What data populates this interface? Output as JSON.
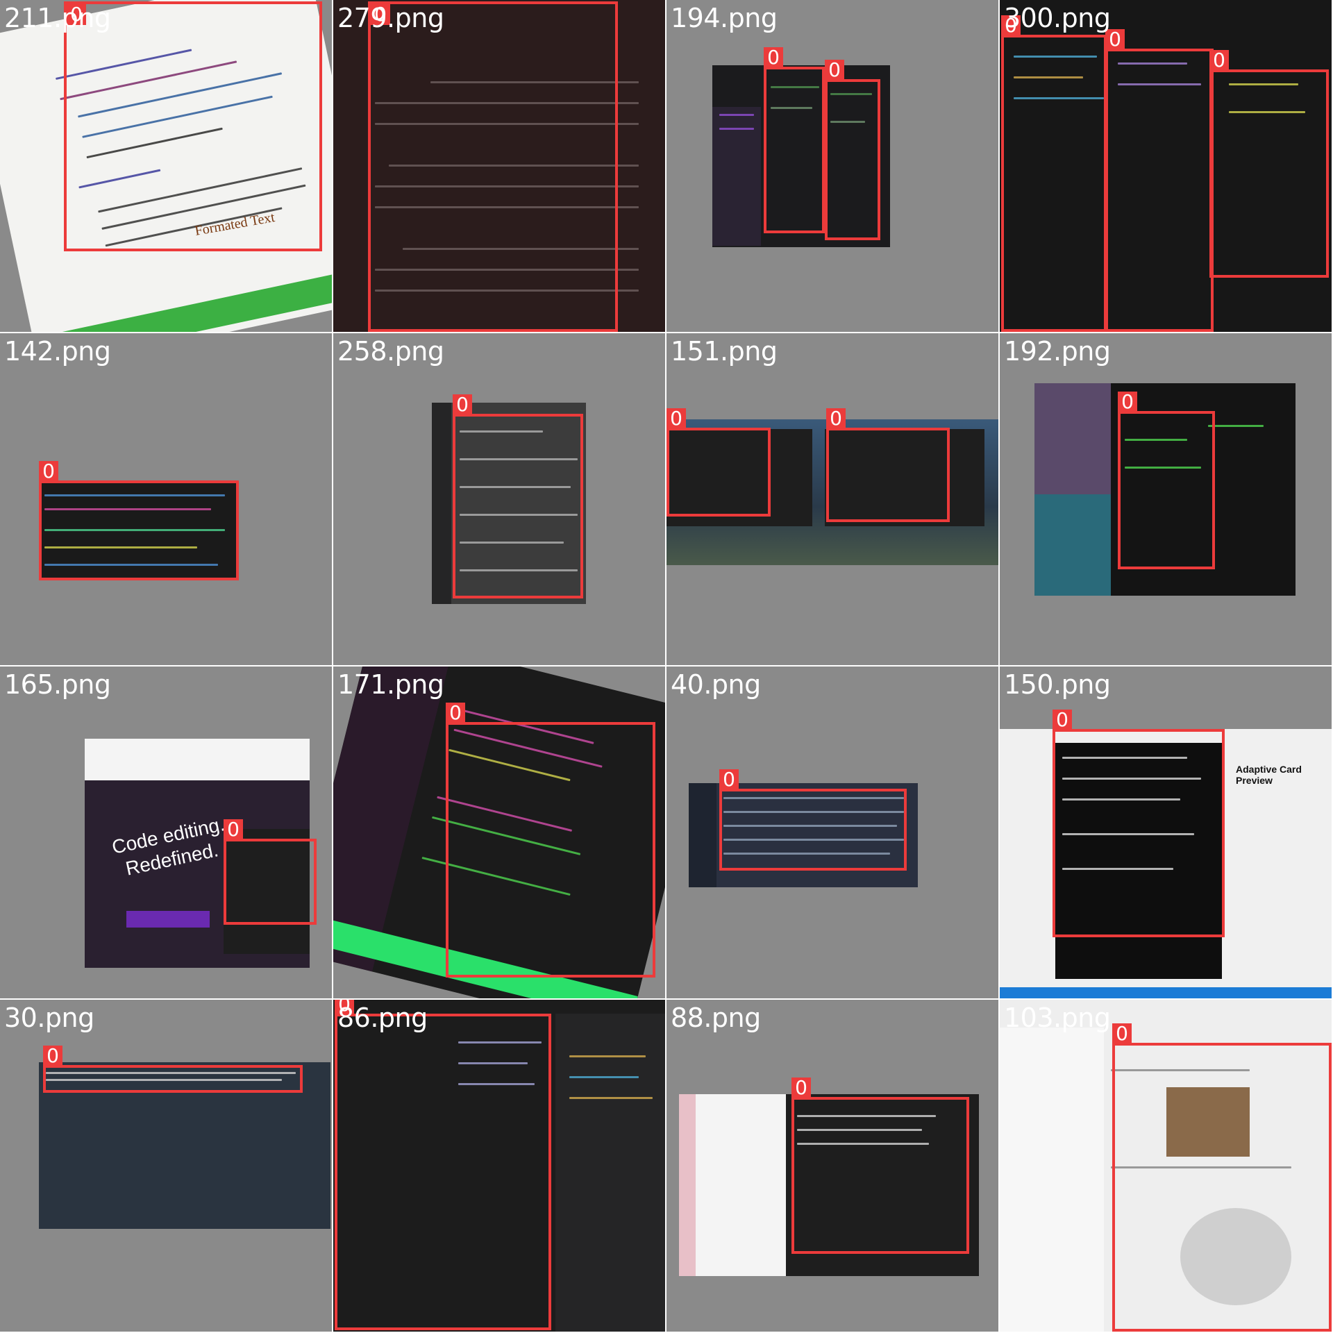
{
  "tiles": [
    {
      "label": "211.png",
      "caption": "Formated Text"
    },
    {
      "label": "279.png"
    },
    {
      "label": "194.png"
    },
    {
      "label": "300.png"
    },
    {
      "label": "142.png"
    },
    {
      "label": "258.png"
    },
    {
      "label": "151.png"
    },
    {
      "label": "192.png"
    },
    {
      "label": "165.png",
      "slogan_line1": "Code editing.",
      "slogan_line2": "Redefined."
    },
    {
      "label": "171.png"
    },
    {
      "label": "40.png"
    },
    {
      "label": "150.png",
      "panel_title": "Adaptive Card Preview"
    },
    {
      "label": "30.png"
    },
    {
      "label": "86.png"
    },
    {
      "label": "88.png"
    },
    {
      "label": "103.png"
    }
  ],
  "class_label": "0",
  "colors": {
    "box": "#ec3b3b",
    "tile_bg": "#8a8a8a",
    "label": "#ffffff"
  }
}
